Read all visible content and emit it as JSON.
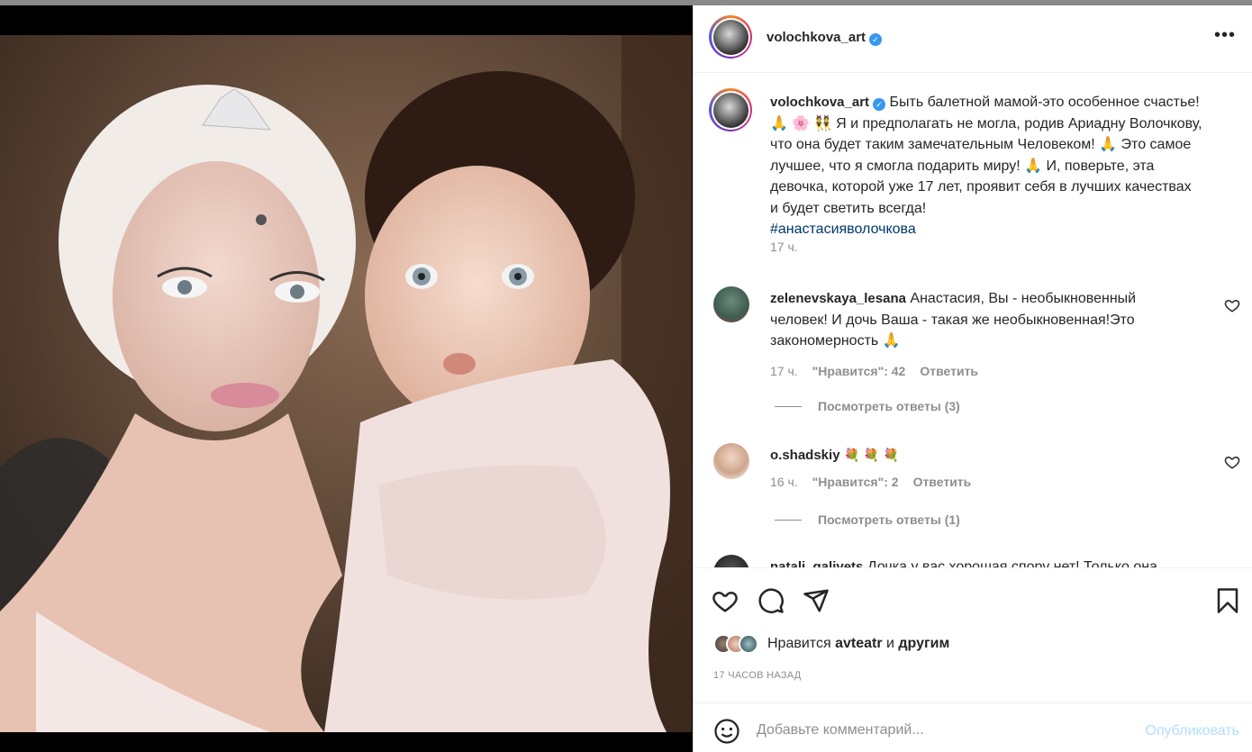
{
  "post": {
    "username": "volochkova_art",
    "verified_icon": "verified-badge-icon",
    "more_icon": "more-options-icon"
  },
  "caption": {
    "username": "volochkova_art",
    "text_1": "Быть балетной мамой-это особенное счастье! 🙏 🌸 👯 Я и предполагать не могла, родив Ариадну Волочкову, что она будет таким замечательным Человеком! 🙏 Это самое лучшее, что я смогла подарить миру! 🙏 И, поверьте, эта девочка, которой уже 17 лет, проявит себя в лучших качествах и будет светить всегда!",
    "hashtag": "#анастасияволочкова",
    "time": "17 ч."
  },
  "comments": [
    {
      "username": "zelenevskaya_lesana",
      "text": "Анастасия, Вы - необыкновенный человек! И дочь Ваша - такая же необыкновенная!Это закономерность 🙏",
      "time": "17 ч.",
      "likes": "\"Нравится\": 42",
      "reply": "Ответить",
      "view_replies": "Посмотреть ответы (3)"
    },
    {
      "username": "o.shadskiy",
      "text": "💐 💐 💐",
      "time": "16 ч.",
      "likes": "\"Нравится\": 2",
      "reply": "Ответить",
      "view_replies": "Посмотреть ответы (1)"
    },
    {
      "username": "natali_galivets",
      "text": "Дочка у вас хорошая спору нет! Только она"
    }
  ],
  "actions": {
    "liked_by_prefix": "Нравится",
    "liked_by_user": "avteatr",
    "liked_by_and": "и",
    "liked_by_others": "другим",
    "timestamp": "17 ЧАСОВ НАЗАД"
  },
  "add_comment": {
    "placeholder": "Добавьте комментарий...",
    "publish_label": "Опубликовать"
  },
  "colors": {
    "accent": "#3897f0",
    "publish_disabled": "#b2dffc",
    "secondary_text": "#8e8e8e",
    "hashtag": "#00376b"
  }
}
